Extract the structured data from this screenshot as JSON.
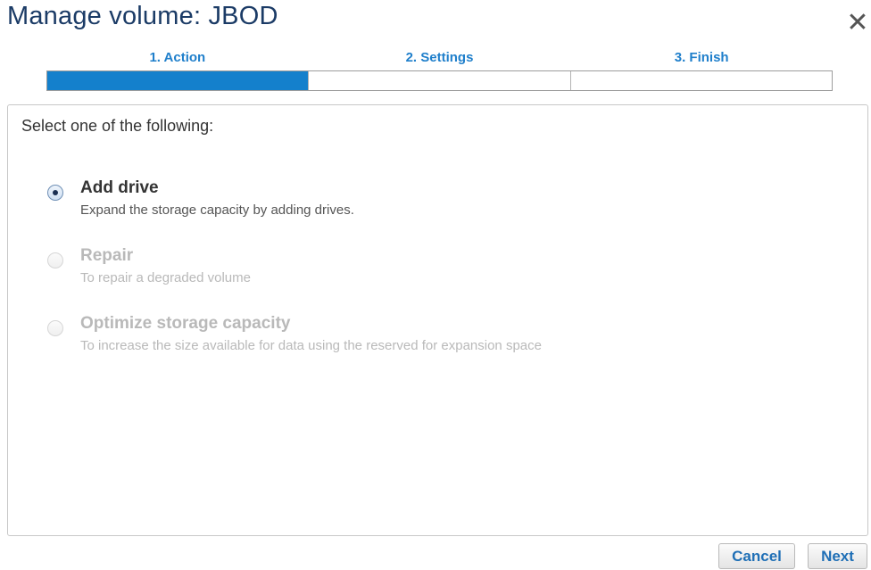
{
  "dialog": {
    "title": "Manage volume: JBOD",
    "close_icon": "close-icon"
  },
  "steps": [
    {
      "label": "1. Action",
      "completed": true
    },
    {
      "label": "2. Settings",
      "completed": false
    },
    {
      "label": "3. Finish",
      "completed": false
    }
  ],
  "panel": {
    "prompt": "Select one of the following:",
    "options": [
      {
        "title": "Add drive",
        "description": "Expand the storage capacity by adding drives.",
        "selected": true,
        "enabled": true
      },
      {
        "title": "Repair",
        "description": "To repair a degraded volume",
        "selected": false,
        "enabled": false
      },
      {
        "title": "Optimize storage capacity",
        "description": "To increase the size available for data using the reserved for expansion space",
        "selected": false,
        "enabled": false
      }
    ]
  },
  "buttons": {
    "cancel": "Cancel",
    "next": "Next"
  },
  "colors": {
    "title": "#1b3b66",
    "accent": "#1480cc",
    "step_label": "#1f7fcb",
    "button_text": "#1f6fb6",
    "disabled_text": "#b9b9b9"
  }
}
